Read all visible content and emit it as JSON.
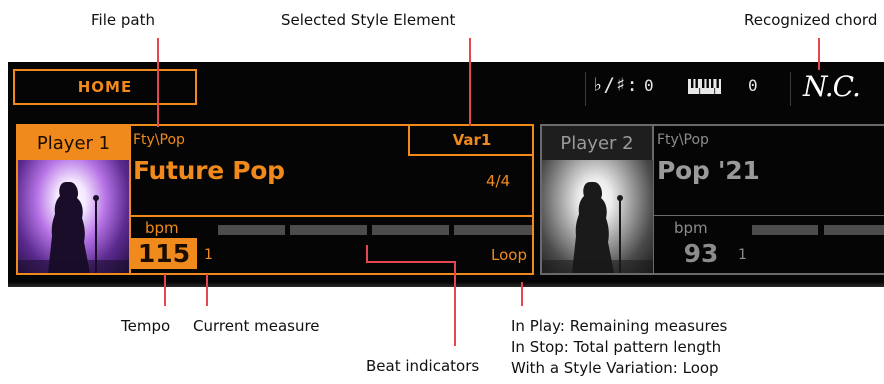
{
  "callouts": {
    "file_path": "File path",
    "selected_style_element": "Selected Style Element",
    "recognized_chord": "Recognized chord",
    "tempo": "Tempo",
    "current_measure": "Current measure",
    "beat_indicators": "Beat indicators",
    "remaining_line1": "In Play: Remaining measures",
    "remaining_line2": "In Stop: Total pattern length",
    "remaining_line3": "With a Style Variation: Loop"
  },
  "topbar": {
    "home_label": "HOME",
    "transpose_label": "♭/♯:",
    "transpose_value": "0",
    "keyboard_icon": "piano-keys-icon",
    "keyboard_value": "0",
    "chord": "N.C."
  },
  "player1": {
    "label": "Player 1",
    "path": "Fty\\Pop",
    "style_name": "Future Pop",
    "element": "Var1",
    "meter": "4/4",
    "bpm_label": "bpm",
    "tempo": "115",
    "measure": "1",
    "loop": "Loop",
    "active": true
  },
  "player2": {
    "label": "Player 2",
    "path": "Fty\\Pop",
    "style_name": "Pop '21",
    "bpm_label": "bpm",
    "tempo": "93",
    "measure": "1",
    "active": false
  },
  "colors": {
    "accent": "#f08a1c",
    "leader": "#e4474f",
    "screen": "#050505",
    "inactive": "#8c8c8c"
  }
}
